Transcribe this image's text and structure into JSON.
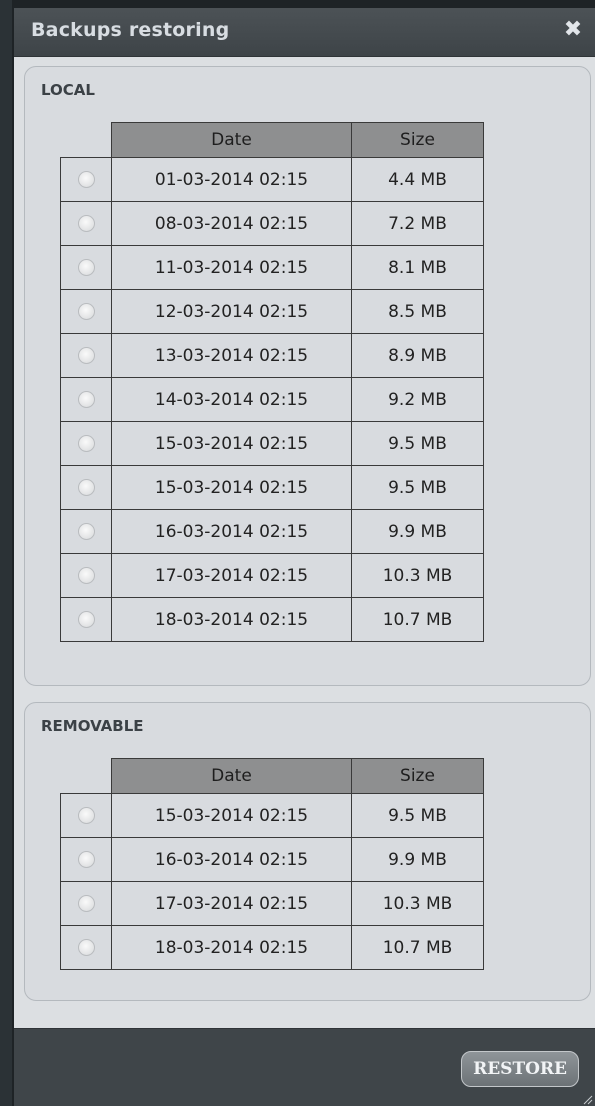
{
  "dialog": {
    "title": "Backups restoring",
    "close_glyph": "✖"
  },
  "local": {
    "heading": "LOCAL",
    "col_date": "Date",
    "col_size": "Size",
    "rows": [
      {
        "date": "01-03-2014 02:15",
        "size": "4.4 MB"
      },
      {
        "date": "08-03-2014 02:15",
        "size": "7.2 MB"
      },
      {
        "date": "11-03-2014 02:15",
        "size": "8.1 MB"
      },
      {
        "date": "12-03-2014 02:15",
        "size": "8.5 MB"
      },
      {
        "date": "13-03-2014 02:15",
        "size": "8.9 MB"
      },
      {
        "date": "14-03-2014 02:15",
        "size": "9.2 MB"
      },
      {
        "date": "15-03-2014 02:15",
        "size": "9.5 MB"
      },
      {
        "date": "15-03-2014 02:15",
        "size": "9.5 MB"
      },
      {
        "date": "16-03-2014 02:15",
        "size": "9.9 MB"
      },
      {
        "date": "17-03-2014 02:15",
        "size": "10.3 MB"
      },
      {
        "date": "18-03-2014 02:15",
        "size": "10.7 MB"
      }
    ]
  },
  "removable": {
    "heading": "REMOVABLE",
    "col_date": "Date",
    "col_size": "Size",
    "rows": [
      {
        "date": "15-03-2014 02:15",
        "size": "9.5 MB"
      },
      {
        "date": "16-03-2014 02:15",
        "size": "9.9 MB"
      },
      {
        "date": "17-03-2014 02:15",
        "size": "10.3 MB"
      },
      {
        "date": "18-03-2014 02:15",
        "size": "10.7 MB"
      }
    ]
  },
  "footer": {
    "restore_label": "RESTORE"
  }
}
